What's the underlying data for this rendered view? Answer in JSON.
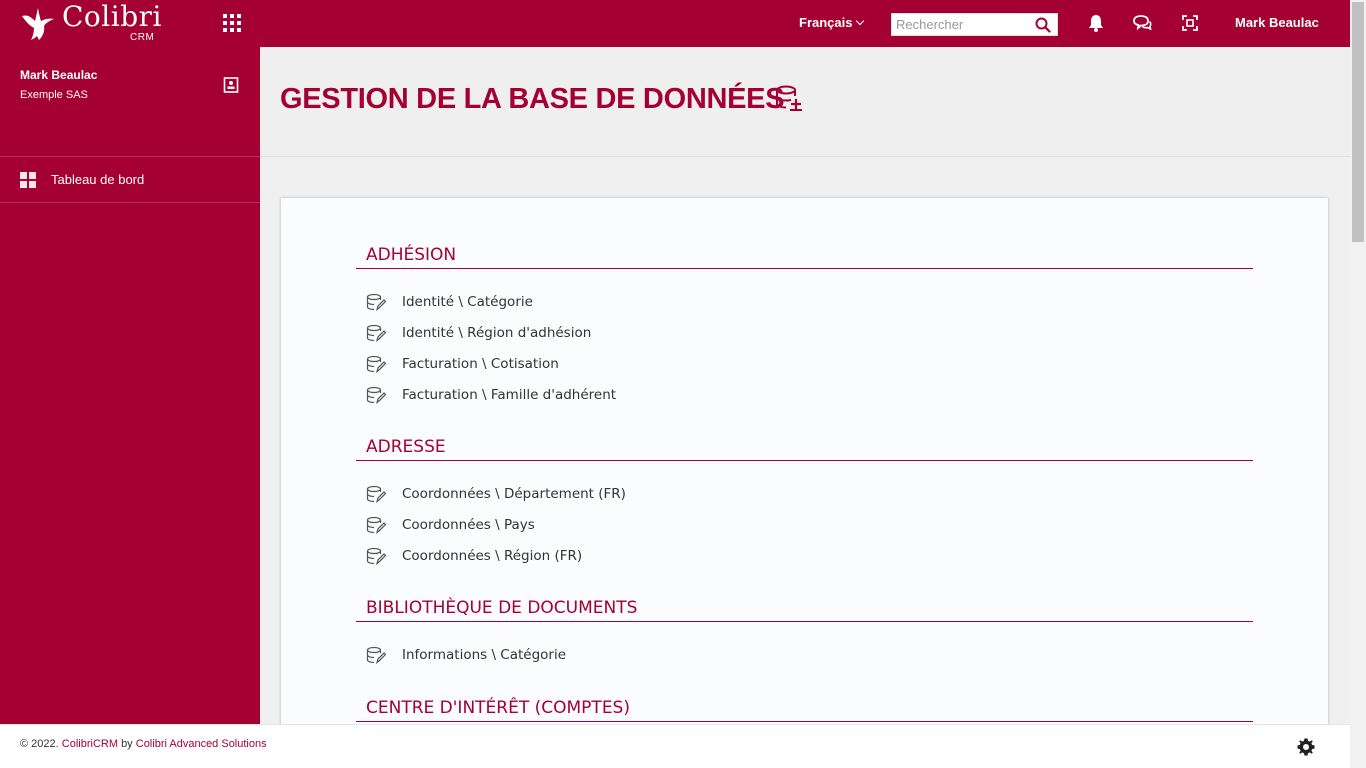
{
  "app": {
    "brand": "Colibri",
    "brand_sub": "CRM",
    "accent_color": "#a50034"
  },
  "topbar": {
    "language": "Français",
    "search_placeholder": "Rechercher",
    "user": "Mark Beaulac",
    "icons": [
      "apps-grid-icon",
      "search-icon",
      "bell-icon",
      "chat-icon",
      "fullscreen-icon"
    ]
  },
  "sidebar": {
    "user_name": "Mark Beaulac",
    "company": "Exemple SAS",
    "items": [
      {
        "label": "Tableau de bord",
        "icon": "dashboard-icon"
      }
    ]
  },
  "page": {
    "title": "GESTION DE LA BASE DE DONNÉES"
  },
  "sections": [
    {
      "title": "ADHÉSION",
      "items": [
        "Identité \\ Catégorie",
        "Identité \\ Région d'adhésion",
        "Facturation \\ Cotisation",
        "Facturation \\ Famille d'adhérent"
      ]
    },
    {
      "title": "ADRESSE",
      "items": [
        "Coordonnées \\ Département (FR)",
        "Coordonnées \\ Pays",
        "Coordonnées \\ Région (FR)"
      ]
    },
    {
      "title": "BIBLIOTHÈQUE DE DOCUMENTS",
      "items": [
        "Informations \\ Catégorie"
      ]
    },
    {
      "title": "CENTRE D'INTÉRÊT (COMPTES)",
      "items": []
    }
  ],
  "footer": {
    "copyright": "© 2022.",
    "product": "ColibriCRM",
    "by": "by",
    "company": "Colibri Advanced Solutions"
  }
}
